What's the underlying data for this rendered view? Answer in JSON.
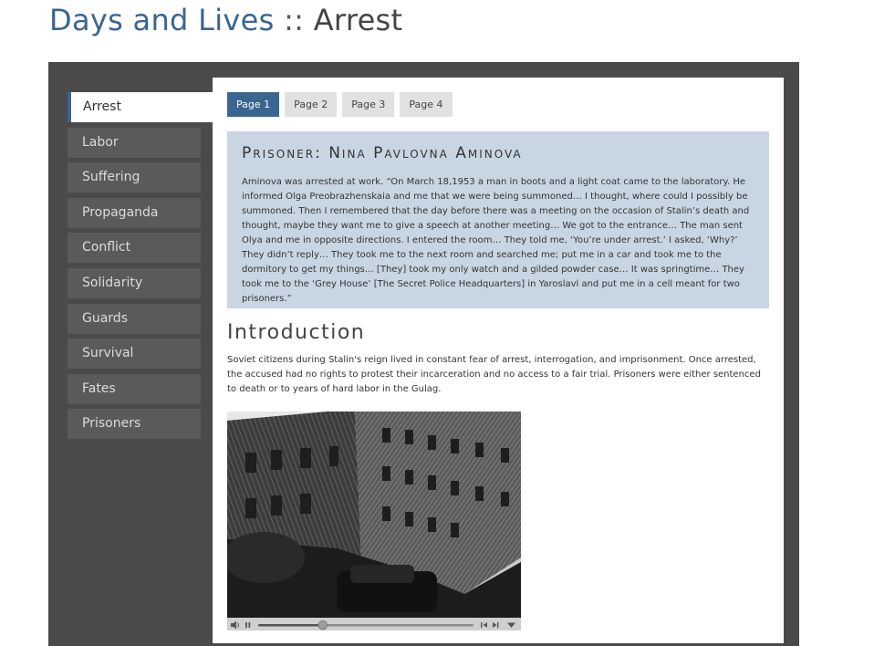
{
  "heading": {
    "site": "Days and Lives",
    "separator": " :: ",
    "section": "Arrest"
  },
  "sidebar": {
    "items": [
      {
        "label": "Arrest"
      },
      {
        "label": "Labor"
      },
      {
        "label": "Suffering"
      },
      {
        "label": "Propaganda"
      },
      {
        "label": "Conflict"
      },
      {
        "label": "Solidarity"
      },
      {
        "label": "Guards"
      },
      {
        "label": "Survival"
      },
      {
        "label": "Fates"
      },
      {
        "label": "Prisoners"
      }
    ],
    "active_index": 0
  },
  "tabs": [
    {
      "label": "Page 1"
    },
    {
      "label": "Page 2"
    },
    {
      "label": "Page 3"
    },
    {
      "label": "Page 4"
    }
  ],
  "quote": {
    "title": "Prisoner: Nina Pavlovna Aminova",
    "text": "Aminova was arrested at work. “On March 18,1953 a man in boots and a light coat came to the laboratory. He informed Olga Preobrazhenskaia and me that we were being summoned… I thought, where could I possibly be summoned. Then I remembered that the day before there was a meeting on the occasion of Stalin’s death and thought, maybe they want me to give a speech at another meeting… We got to the entrance… The man sent Olya and me in opposite directions. I entered the room… They told me, ‘You’re under arrest.’ I asked, ‘Why?’ They didn’t reply… They took me to the next room and searched me; put me in a car and took me to the dormitory to get my things… [They] took my only watch and a gilded powder case… It was springtime… They took me to the ‘Grey House’ [The Secret Police Headquarters] in Yaroslavl and put me in a cell meant for two prisoners.”"
  },
  "intro": {
    "title": "Introduction",
    "text": "Soviet citizens during Stalin's reign lived in constant fear of arrest, interrogation, and imprisonment. Once arrested, the accused had no rights to protest their incarceration and no access to a fair trial. Prisoners were either sentenced to death or to years of hard labor in the Gulag."
  },
  "video": {
    "progress": 0.3
  },
  "colors": {
    "accent": "#3a6591",
    "frame": "#4a4a4a",
    "nav_item": "#5a5a5a",
    "quote_bg": "#c8d6e4"
  },
  "icons": {
    "volume": "speaker-icon",
    "play": "pause-icon",
    "rewind": "skip-back-icon",
    "forward": "skip-forward-icon",
    "menu": "triangle-down-icon"
  }
}
